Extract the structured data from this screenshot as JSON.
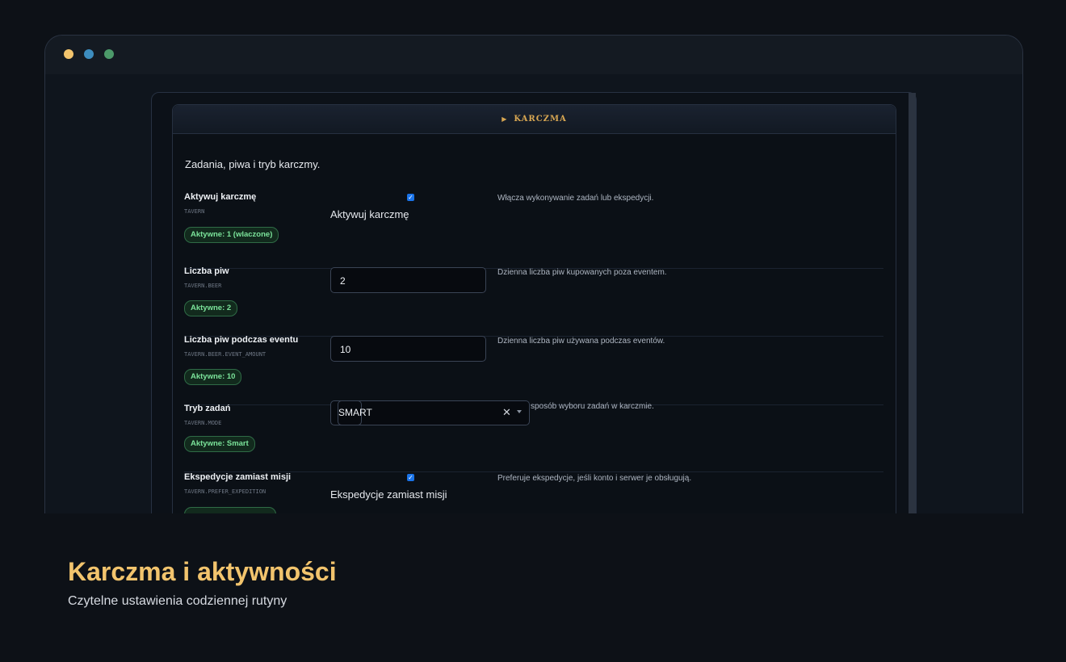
{
  "panel": {
    "title": "KARCZMA",
    "description": "Zadania, piwa i tryb karczmy."
  },
  "rows": [
    {
      "label": "Aktywuj karczmę",
      "key": "TAVERN",
      "badge": "Aktywne: 1 (wlaczone)",
      "control": "checkbox",
      "checked": true,
      "control_label": "Aktywuj karczmę",
      "help": "Włącza wykonywanie zadań lub ekspedycji."
    },
    {
      "label": "Liczba piw",
      "key": "TAVERN.BEER",
      "badge": "Aktywne: 2",
      "control": "input",
      "value": "2",
      "help": "Dzienna liczba piw kupowanych poza eventem."
    },
    {
      "label": "Liczba piw podczas eventu",
      "key": "TAVERN.BEER.EVENT_AMOUNT",
      "badge": "Aktywne: 10",
      "control": "input",
      "value": "10",
      "help": "Dzienna liczba piw używana podczas eventów."
    },
    {
      "label": "Tryb zadań",
      "key": "TAVERN.MODE",
      "badge": "Aktywne: Smart",
      "control": "select",
      "value": "SMART",
      "help": "sposób wyboru zadań w karczmie."
    },
    {
      "label": "Ekspedycje zamiast misji",
      "key": "TAVERN.PREFER_EXPEDITION",
      "badge": "",
      "control": "checkbox",
      "checked": true,
      "control_label": "Ekspedycje zamiast misji",
      "help": "Preferuje ekspedycje, jeśli konto i serwer je obsługują."
    }
  ],
  "caption": {
    "title": "Karczma i aktywności",
    "subtitle": "Czytelne ustawienia codziennej rutyny"
  },
  "colors": {
    "accent": "#f2c46d",
    "badge_text": "#7be39a",
    "checkbox": "#1a73e8"
  }
}
